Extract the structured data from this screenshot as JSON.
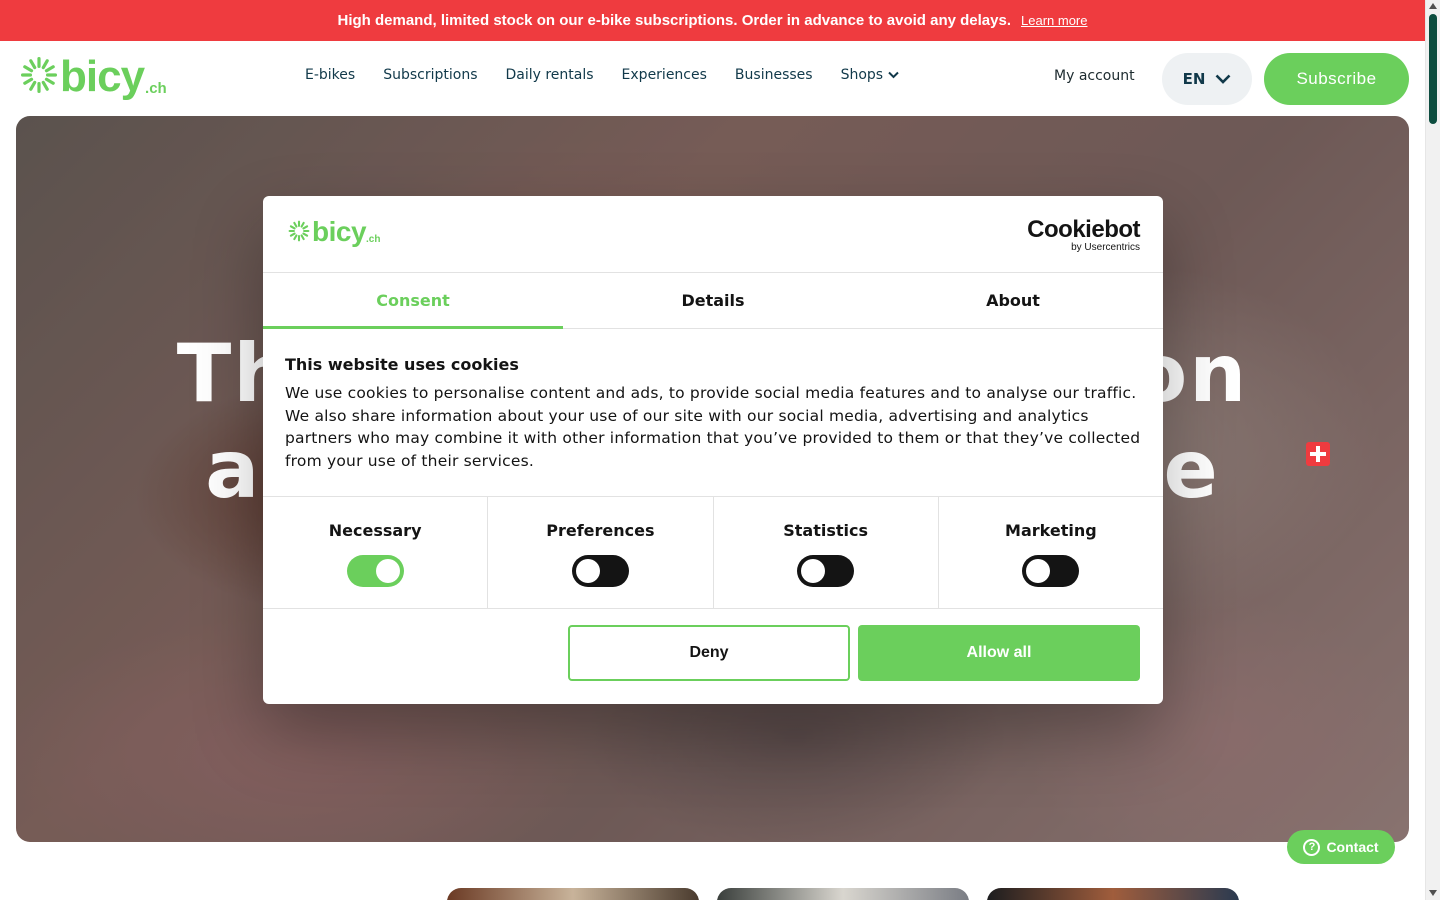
{
  "announcement": {
    "message": "High demand, limited stock on our e-bike subscriptions. Order in advance to avoid any delays.",
    "link": "Learn more"
  },
  "header": {
    "logo_word": "bicy",
    "logo_tld": ".ch",
    "nav": [
      "E-bikes",
      "Subscriptions",
      "Daily rentals",
      "Experiences",
      "Businesses",
      "Shops"
    ],
    "my_account": "My account",
    "language": "EN",
    "subscribe": "Subscribe"
  },
  "hero": {
    "line1_left": "Th",
    "line1_right": "on",
    "line2_left": "all-",
    "line2_right": "ible"
  },
  "contact": {
    "label": "Contact",
    "icon": "?"
  },
  "cookie_dialog": {
    "logo_word": "bicy",
    "logo_tld": ".ch",
    "provider": "Cookiebot",
    "provider_by": "by Usercentrics",
    "tabs": [
      "Consent",
      "Details",
      "About"
    ],
    "active_tab": "Consent",
    "title": "This website uses cookies",
    "text": "We use cookies to personalise content and ads, to provide social media features and to analyse our traffic. We also share information about your use of our site with our social media, advertising and analytics partners who may combine it with other information that you’ve provided to them or that they’ve collected from your use of their services.",
    "toggles": [
      {
        "label": "Necessary",
        "on": true
      },
      {
        "label": "Preferences",
        "on": false
      },
      {
        "label": "Statistics",
        "on": false
      },
      {
        "label": "Marketing",
        "on": false
      }
    ],
    "deny": "Deny",
    "allow_all": "Allow all"
  },
  "colors": {
    "brand_green": "#6bcf5c",
    "announce_red": "#ef3b3f",
    "nav_text": "#11394a"
  }
}
